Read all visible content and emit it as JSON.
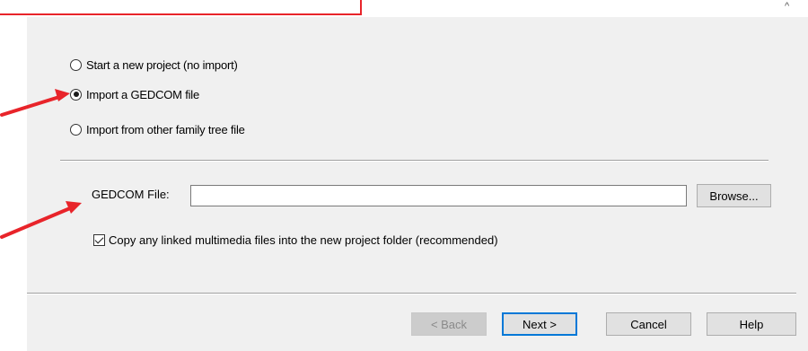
{
  "window": {
    "corner_glyph": "^"
  },
  "import_options": [
    {
      "label": "Start a new project (no import)",
      "selected": false
    },
    {
      "label": "Import a GEDCOM file",
      "selected": true
    },
    {
      "label": "Import from other family tree file",
      "selected": false
    }
  ],
  "gedcom": {
    "label": "GEDCOM File:",
    "value": "",
    "browse_label": "Browse..."
  },
  "copy_media": {
    "label": "Copy any linked multimedia files into the new project folder (recommended)",
    "checked": true
  },
  "footer": {
    "back_label": "< Back",
    "next_label": "Next >",
    "cancel_label": "Cancel",
    "help_label": "Help"
  },
  "colors": {
    "annotation_red": "#e8242a",
    "dialog_bg": "#f0f0f0",
    "default_button_border": "#0078d7"
  }
}
